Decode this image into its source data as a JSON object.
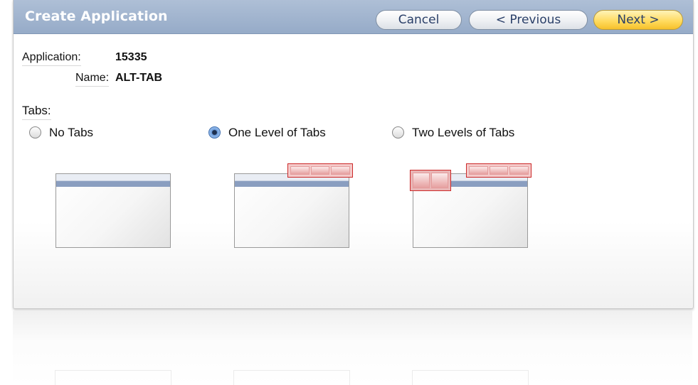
{
  "header": {
    "title": "Create Application"
  },
  "buttons": {
    "cancel": "Cancel",
    "previous": "< Previous",
    "next": "Next >"
  },
  "info": {
    "application_label": "Application:",
    "application_value": "15335",
    "name_label": "Name:",
    "name_value": "ALT-TAB"
  },
  "tabs": {
    "label": "Tabs:",
    "options": [
      {
        "label": "No Tabs",
        "checked": false
      },
      {
        "label": "One Level of Tabs",
        "checked": true
      },
      {
        "label": "Two Levels of Tabs",
        "checked": false
      }
    ]
  },
  "colors": {
    "header_bg": "#96abc8",
    "next_button": "#ffd95a",
    "tab_highlight": "#cc2a2a",
    "window_bar": "#8a9ec0"
  }
}
